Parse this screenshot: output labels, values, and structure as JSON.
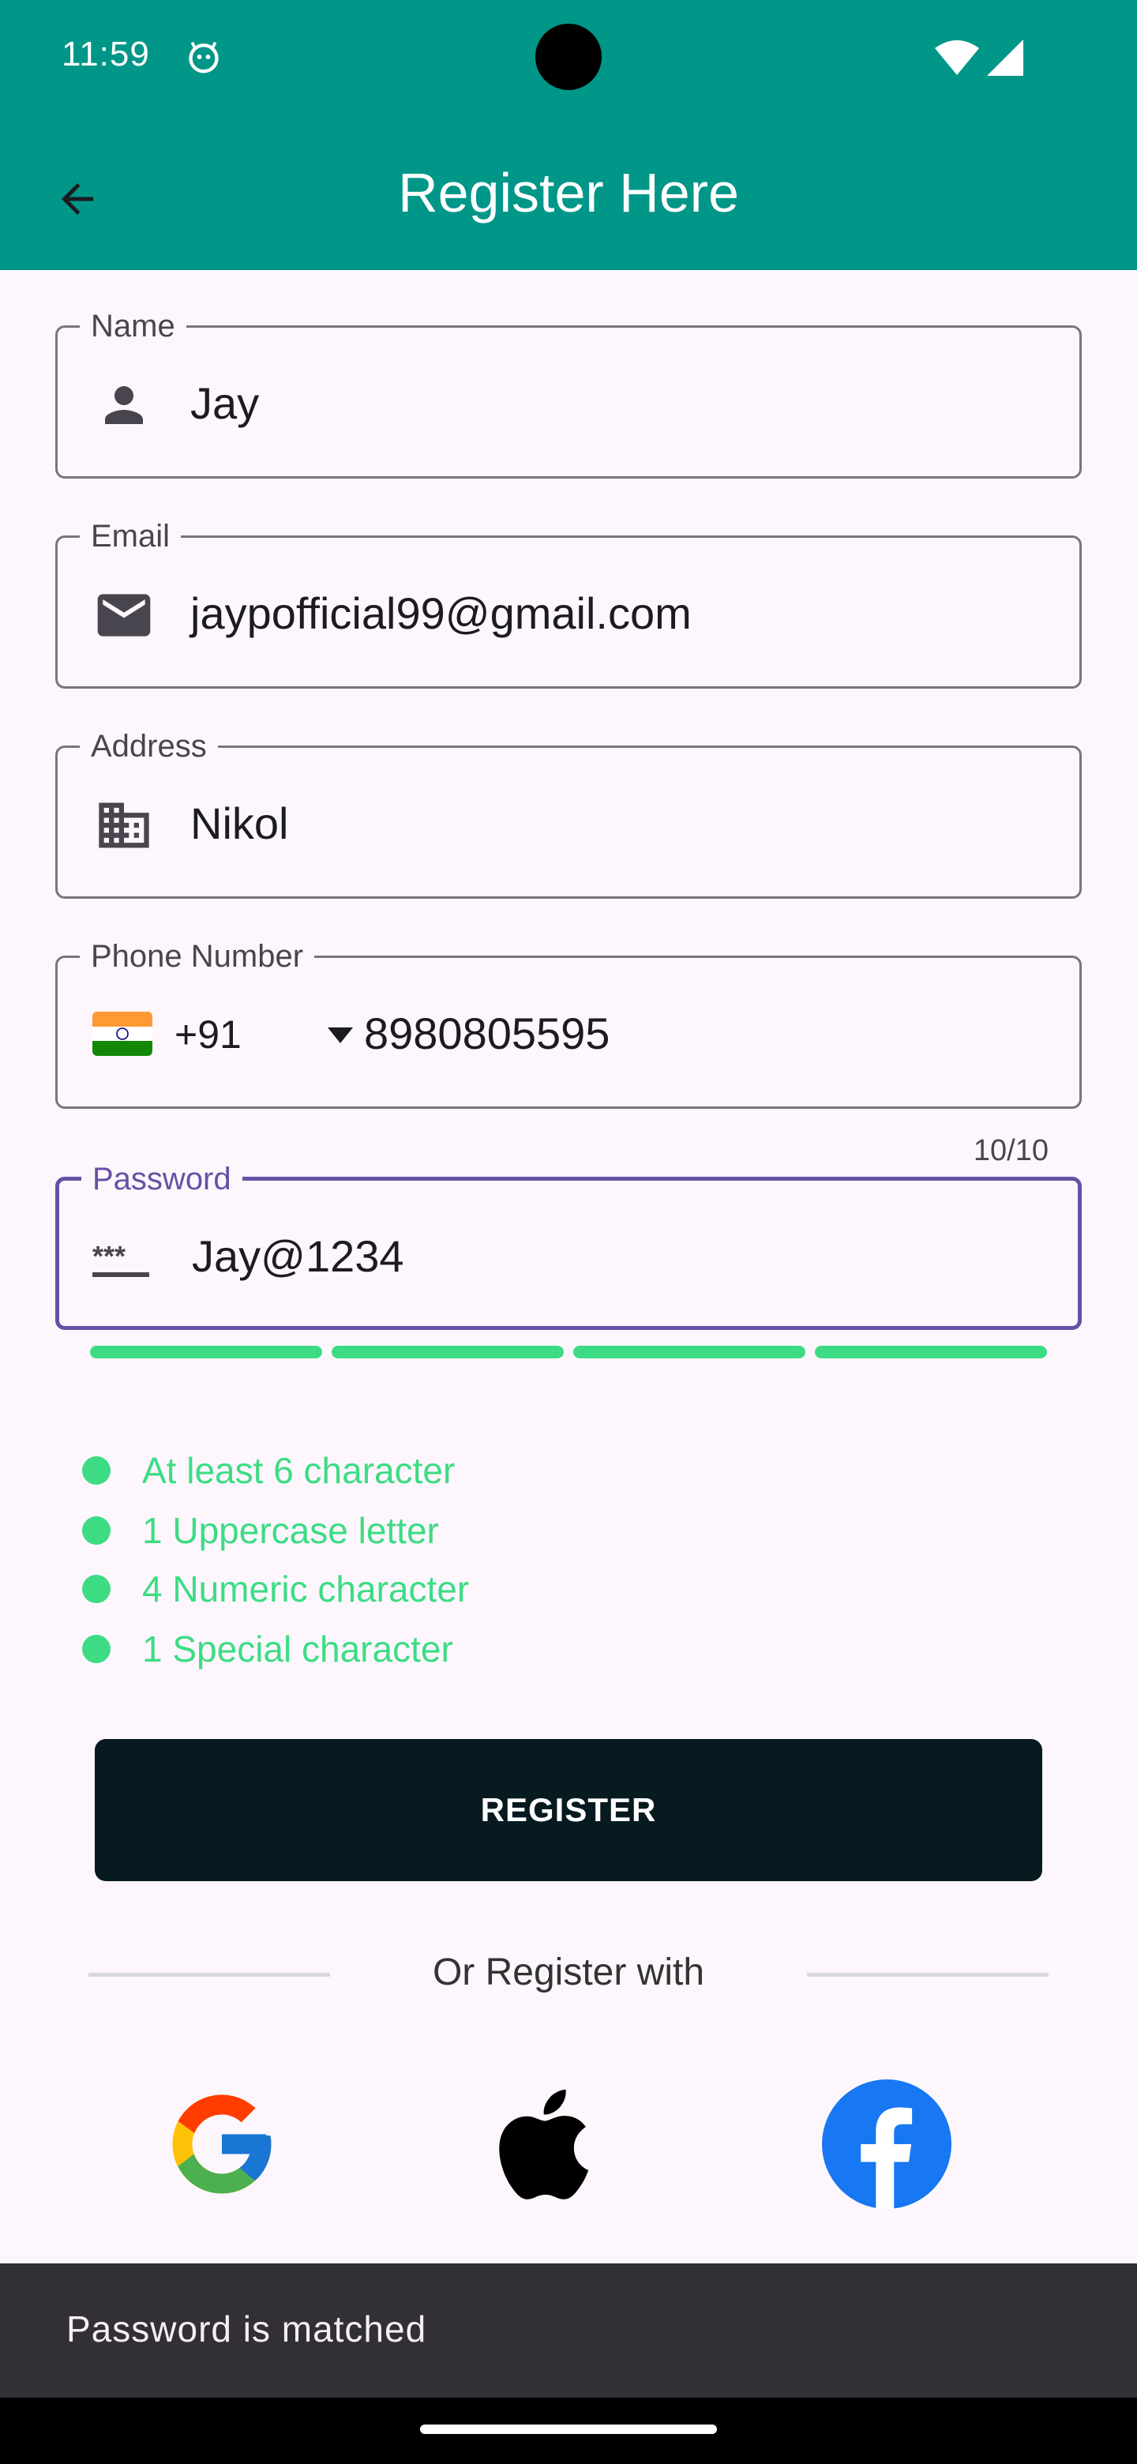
{
  "status_bar": {
    "time": "11:59"
  },
  "app_bar": {
    "title": "Register Here"
  },
  "form": {
    "name": {
      "label": "Name",
      "value": "Jay",
      "icon": "person-icon"
    },
    "email": {
      "label": "Email",
      "value": "jaypofficial99@gmail.com",
      "icon": "mail-icon"
    },
    "address": {
      "label": "Address",
      "value": "Nikol",
      "icon": "business-icon"
    },
    "phone": {
      "label": "Phone Number",
      "country_code": "+91",
      "value": "8980805595",
      "flag": "india-flag"
    },
    "password": {
      "label": "Password",
      "value": "Jay@1234",
      "counter": "10/10",
      "icon": "password-icon",
      "strength_segments_filled": 4,
      "strength_segments_total": 4,
      "strength_color": "#3ddc84"
    }
  },
  "password_rules": [
    {
      "text": "At least 6 character"
    },
    {
      "text": "1 Uppercase letter"
    },
    {
      "text": "4 Numeric character"
    },
    {
      "text": "1 Special character"
    }
  ],
  "register_button": {
    "label": "REGISTER"
  },
  "divider": {
    "text": "Or Register with"
  },
  "social": [
    {
      "name": "google-icon"
    },
    {
      "name": "apple-icon"
    },
    {
      "name": "facebook-icon"
    }
  ],
  "snackbar": {
    "message": "Password is matched"
  },
  "colors": {
    "primary": "#009688",
    "focus": "#6750a4",
    "success": "#3ddc84",
    "button": "#061a20"
  }
}
